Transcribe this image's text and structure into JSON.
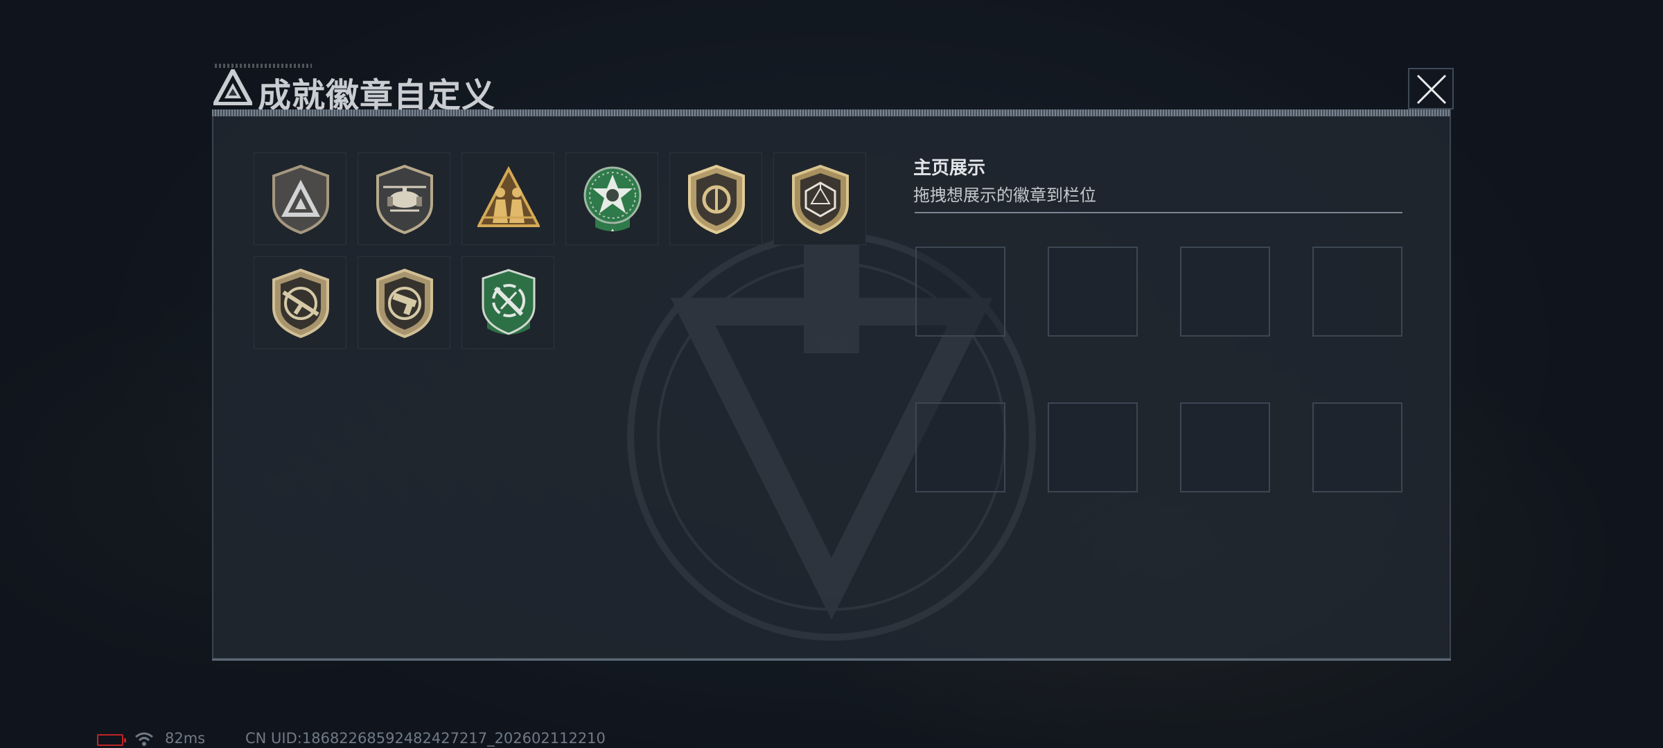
{
  "dialog": {
    "title": "成就徽章自定义",
    "close_icon": "close-icon"
  },
  "badges": [
    {
      "name": "delta-triangle-shield-badge",
      "color": "#9a8e7a"
    },
    {
      "name": "helicopter-shield-badge",
      "color": "#b7a98b"
    },
    {
      "name": "soldiers-triangle-badge",
      "color": "#d4a954"
    },
    {
      "name": "green-star-skull-badge",
      "color": "#2f7a4a"
    },
    {
      "name": "ring-shield-badge",
      "color": "#c7b07b"
    },
    {
      "name": "polyhedron-shield-badge",
      "color": "#b9a272"
    },
    {
      "name": "rifle-shield-badge",
      "color": "#b8a57c"
    },
    {
      "name": "pistol-shield-badge",
      "color": "#b8a57c"
    },
    {
      "name": "green-knife-crosshair-badge",
      "color": "#2e7046"
    }
  ],
  "showcase": {
    "title": "主页展示",
    "subtitle": "拖拽想展示的徽章到栏位",
    "slots": 8
  },
  "status_bar": {
    "battery_icon": "battery-low-icon",
    "wifi_icon": "wifi-icon",
    "ping": "82ms",
    "uid": "CN UID:18682268592482427217_202602112210"
  }
}
